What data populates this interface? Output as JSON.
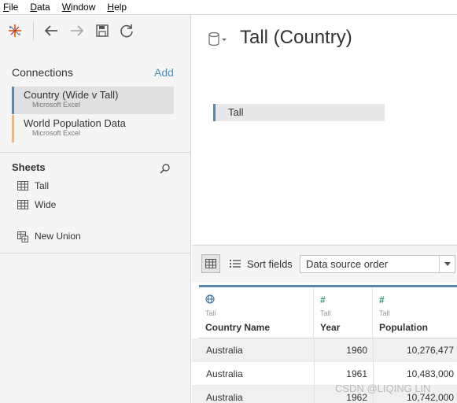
{
  "menu": [
    {
      "label": "File",
      "underline": "F",
      "rest": "ile"
    },
    {
      "label": "Data",
      "underline": "D",
      "rest": "ata"
    },
    {
      "label": "Window",
      "underline": "W",
      "rest": "indow"
    },
    {
      "label": "Help",
      "underline": "H",
      "rest": "elp"
    }
  ],
  "connections": {
    "header": "Connections",
    "add_label": "Add",
    "items": [
      {
        "name": "Country (Wide v Tall)",
        "type": "Microsoft Excel"
      },
      {
        "name": "World Population Data",
        "type": "Microsoft Excel"
      }
    ]
  },
  "sheets": {
    "header": "Sheets",
    "items": [
      {
        "label": "Tall"
      },
      {
        "label": "Wide"
      }
    ],
    "new_union": "New Union"
  },
  "datasource": {
    "title": "Tall (Country)",
    "canvas_table": "Tall"
  },
  "grid_toolbar": {
    "sort_label": "Sort fields",
    "sort_value": "Data source order"
  },
  "grid": {
    "columns": [
      {
        "type_icon": "globe-icon",
        "source": "Tall",
        "name": "Country Name"
      },
      {
        "type_icon": "number-icon",
        "source": "Tall",
        "name": "Year"
      },
      {
        "type_icon": "number-icon",
        "source": "Tall",
        "name": "Population"
      }
    ],
    "rows": [
      [
        "Australia",
        "1960",
        "10,276,477"
      ],
      [
        "Australia",
        "1961",
        "10,483,000"
      ],
      [
        "Australia",
        "1962",
        "10,742,000"
      ]
    ]
  },
  "watermark": "CSDN @LIQING LIN",
  "colors": {
    "accent_blue": "#5b87a8",
    "accent_orange": "#f2b57a",
    "link_blue": "#4a90bf",
    "number_green": "#2e9e6e"
  }
}
